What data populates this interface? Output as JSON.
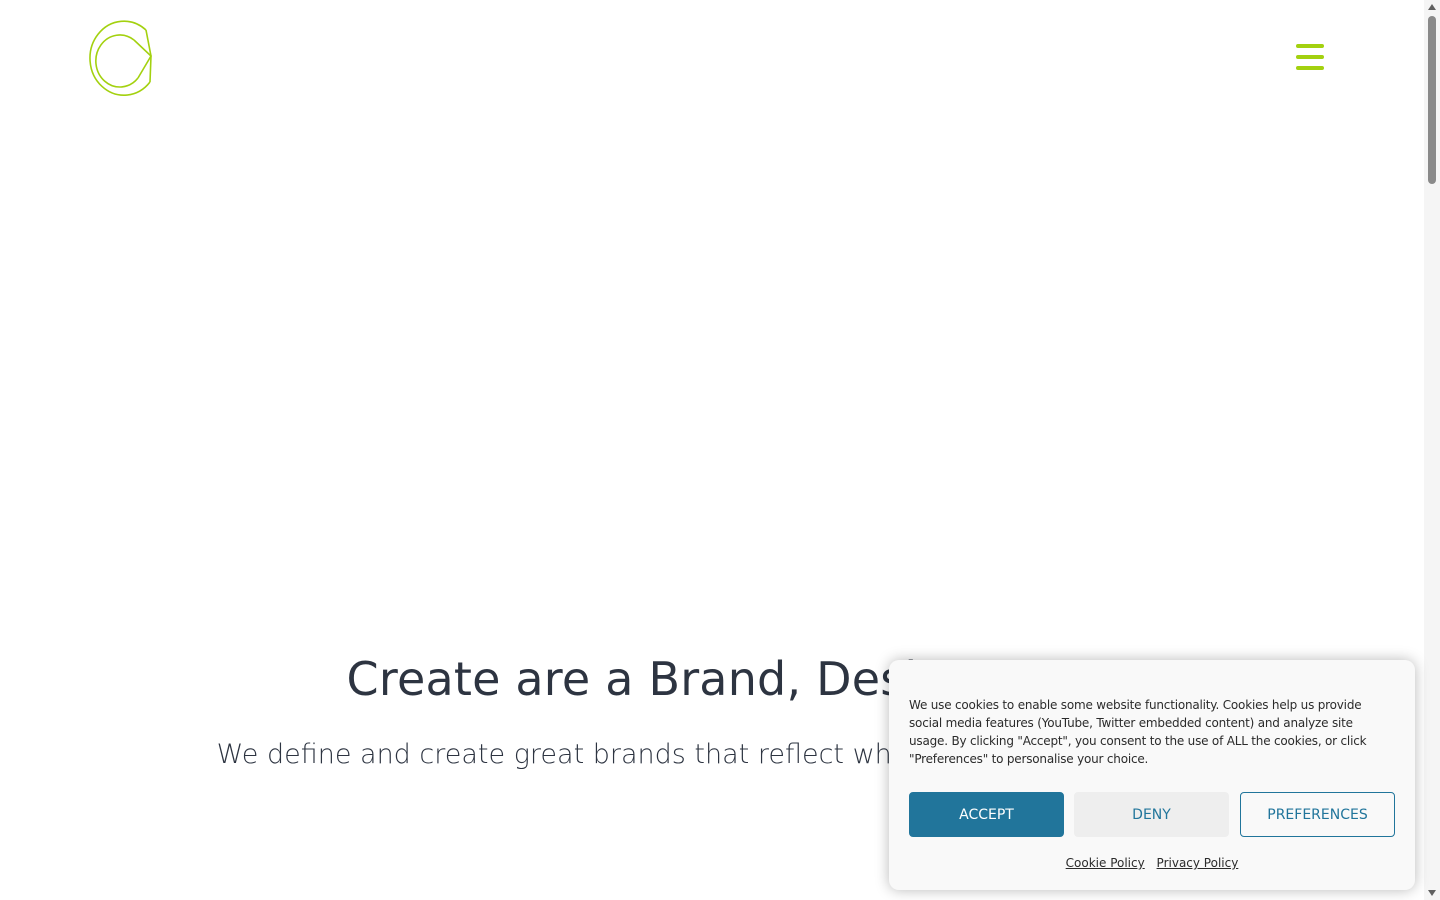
{
  "brand": {
    "logo_icon": "c-outline-logo-icon",
    "accent_color": "#a3d10f"
  },
  "header": {
    "menu_icon": "hamburger-menu-icon"
  },
  "hero": {
    "title": "Create are a Brand, Design & D",
    "subtitle": "We define and create great brands that reflect who you a ideal customer."
  },
  "cookie_banner": {
    "text": "We use cookies to enable some website functionality. Cookies help us provide social media features (YouTube, Twitter embedded content) and analyze site usage. By clicking \"Accept\", you consent to the use of ALL the cookies, or click \"Preferences\" to personalise your choice.",
    "accept_label": "ACCEPT",
    "deny_label": "DENY",
    "preferences_label": "PREFERENCES",
    "links": [
      {
        "label": "Cookie Policy"
      },
      {
        "label": "Privacy Policy"
      }
    ],
    "primary_color": "#21759b"
  }
}
